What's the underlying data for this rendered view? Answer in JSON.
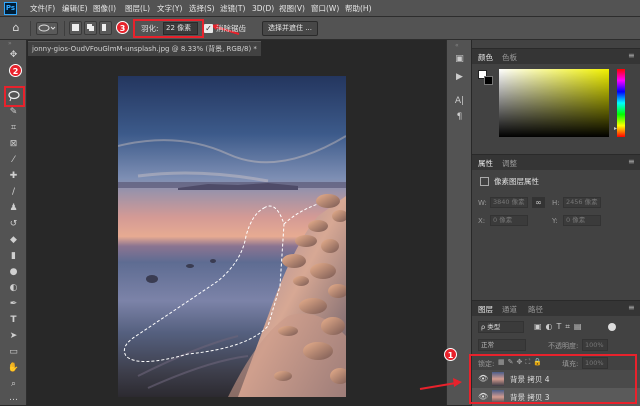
{
  "app": {
    "logo": "Ps",
    "menu": [
      "文件(F)",
      "编辑(E)",
      "图像(I)",
      "图层(L)",
      "文字(Y)",
      "选择(S)",
      "滤镜(T)",
      "3D(D)",
      "视图(V)",
      "窗口(W)",
      "帮助(H)"
    ]
  },
  "options": {
    "feather_label": "羽化:",
    "feather_value": "22 像素",
    "antialias_label": "消除锯齿",
    "select_mask_button": "选择并遮住 ..."
  },
  "document": {
    "tab_title": "jonny-gios-OudVFouGlmM-unsplash.jpg @ 8.33% (背景, RGB/8) *"
  },
  "panels": {
    "color_tabs": [
      "颜色",
      "色板"
    ],
    "properties_tabs": [
      "属性",
      "调整"
    ],
    "properties_title": "像素图层属性",
    "prop_w_label": "W:",
    "prop_w_value": "3840 像素",
    "prop_h_label": "H:",
    "prop_h_value": "2456 像素",
    "prop_x_label": "X:",
    "prop_x_value": "0 像素",
    "prop_y_label": "Y:",
    "prop_y_value": "0 像素",
    "prop_link_glyph": "∞",
    "layers_tabs": [
      "图层",
      "通道",
      "路径"
    ],
    "layer_filter": "ρ 类型",
    "blend_mode": "正常",
    "opacity_label": "不透明度:",
    "opacity_value": "100%",
    "lock_label": "锁定:",
    "fill_label": "填充:",
    "fill_value": "100%",
    "layers": [
      {
        "name": "背景 拷贝 4"
      },
      {
        "name": "背景 拷贝 3"
      }
    ]
  },
  "annotations": {
    "badge_1": "1",
    "badge_2": "2",
    "badge_3": "3"
  },
  "colors": {
    "accent_red": "#e8222c",
    "ps_blue": "#31a8ff"
  }
}
